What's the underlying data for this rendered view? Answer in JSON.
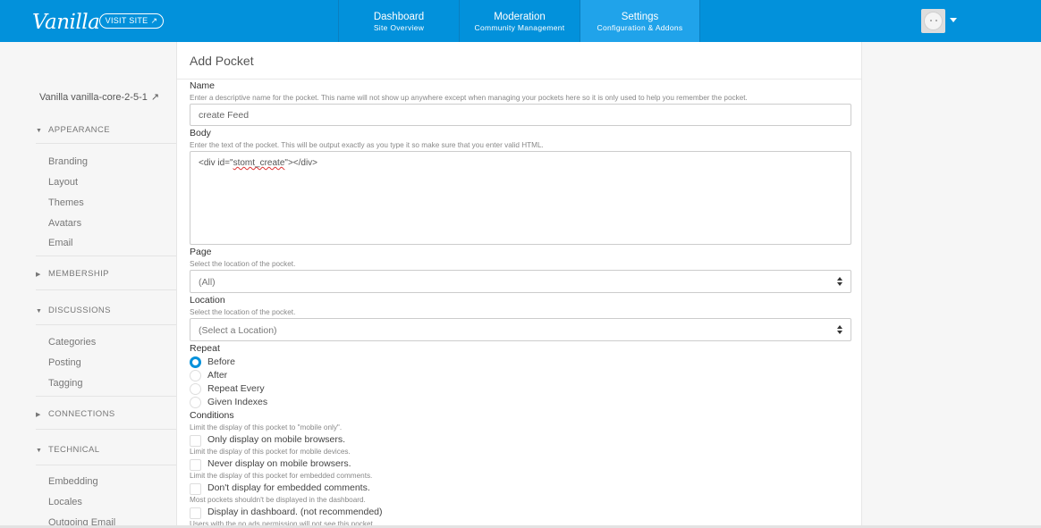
{
  "topbar": {
    "logo": "Vanilla",
    "visit_site": "VISIT SITE",
    "visit_site_icon": "external-arrow-icon",
    "tabs": [
      {
        "title": "Dashboard",
        "subtitle": "Site Overview"
      },
      {
        "title": "Moderation",
        "subtitle": "Community Management"
      },
      {
        "title": "Settings",
        "subtitle": "Configuration & Addons",
        "active": true
      }
    ],
    "accent_color": "#0291db"
  },
  "sidebar": {
    "site_name": "Vanilla vanilla-core-2-5-1",
    "site_link_icon": "external-link-icon",
    "sections": [
      {
        "label": "APPEARANCE",
        "expanded": true,
        "items": [
          "Branding",
          "Layout",
          "Themes",
          "Avatars",
          "Email"
        ]
      },
      {
        "label": "MEMBERSHIP",
        "expanded": false,
        "items": []
      },
      {
        "label": "DISCUSSIONS",
        "expanded": true,
        "items": [
          "Categories",
          "Posting",
          "Tagging"
        ]
      },
      {
        "label": "CONNECTIONS",
        "expanded": false,
        "items": []
      },
      {
        "label": "TECHNICAL",
        "expanded": true,
        "items": [
          "Embedding",
          "Locales",
          "Outgoing Email"
        ]
      }
    ]
  },
  "form": {
    "title": "Add Pocket",
    "name": {
      "label": "Name",
      "hint": "Enter a descriptive name for the pocket. This name will not show up anywhere except when managing your pockets here so it is only used to help you remember the pocket.",
      "value": "create Feed"
    },
    "body": {
      "label": "Body",
      "hint": "Enter the text of the pocket. This will be output exactly as you type it so make sure that you enter valid HTML.",
      "value_before": "<div id=\"",
      "value_squiggle": "stomt_create",
      "value_after": "\"></div>"
    },
    "page": {
      "label": "Page",
      "hint": "Select the location of the pocket.",
      "value": "(All)"
    },
    "location": {
      "label": "Location",
      "hint": "Select the location of the pocket.",
      "value": "(Select a Location)"
    },
    "repeat": {
      "label": "Repeat",
      "options": [
        "Before",
        "After",
        "Repeat Every",
        "Given Indexes"
      ],
      "selected": "Before"
    },
    "conditions": {
      "label": "Conditions",
      "items": [
        {
          "hint": "Limit the display of this pocket to \"mobile only\".",
          "label": "Only display on mobile browsers."
        },
        {
          "hint": "Limit the display of this pocket for mobile devices.",
          "label": "Never display on mobile browsers."
        },
        {
          "hint": "Limit the display of this pocket for embedded comments.",
          "label": "Don't display for embedded comments."
        },
        {
          "hint": "Most pockets shouldn't be displayed in the dashboard.",
          "label": "Display in dashboard. (not recommended)"
        },
        {
          "hint": "Users with the no ads permission will not see this pocket.",
          "label": ""
        }
      ]
    }
  }
}
